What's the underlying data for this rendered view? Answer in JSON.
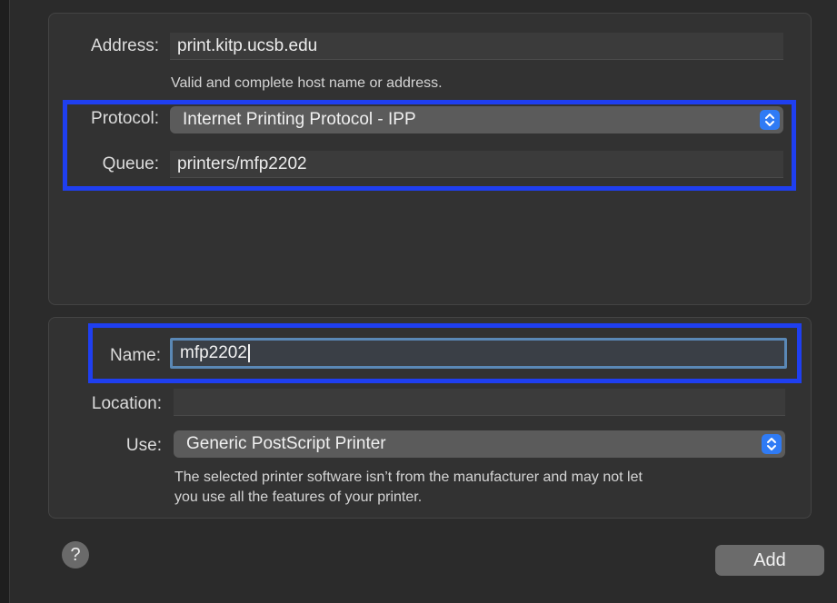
{
  "connection": {
    "address_label": "Address:",
    "address_value": "print.kitp.ucsb.edu",
    "address_hint": "Valid and complete host name or address.",
    "protocol_label": "Protocol:",
    "protocol_value": "Internet Printing Protocol - IPP",
    "queue_label": "Queue:",
    "queue_value": "printers/mfp2202"
  },
  "details": {
    "name_label": "Name:",
    "name_value": "mfp2202",
    "location_label": "Location:",
    "location_value": "",
    "use_label": "Use:",
    "use_value": "Generic PostScript Printer",
    "use_warning_line1": "The selected printer software isn’t from the manufacturer and may not let",
    "use_warning_line2": "you use all the features of your printer."
  },
  "footer": {
    "help_label": "?",
    "add_label": "Add"
  },
  "colors": {
    "highlight": "#1f3ff0",
    "accent": "#2f7bf5"
  }
}
